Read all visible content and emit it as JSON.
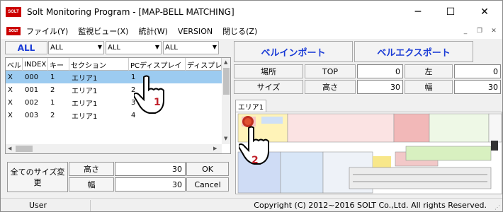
{
  "window": {
    "logo_text": "SOLT",
    "title": "Solt Monitoring Program - [MAP-BELL MATCHING]",
    "minimize": "─",
    "maximize": "☐",
    "close": "✕"
  },
  "menu": {
    "logo_text": "SOLT",
    "items": [
      "ファイル(Y)",
      "監視ビュー(X)",
      "統計(W)",
      "VERSION",
      "閉じる(Z)"
    ],
    "mdi_min": "_",
    "mdi_restore": "❐",
    "mdi_close": "✕"
  },
  "filters": {
    "all_button": "ALL",
    "dropdowns": [
      "ALL",
      "ALL",
      "ALL"
    ]
  },
  "table": {
    "columns": [
      "ベル",
      "INDEX",
      "キー",
      "セクション",
      "PCディスプレイ",
      "ディスプレ"
    ],
    "rows": [
      {
        "bell": "X",
        "index": "000",
        "key": "1",
        "section": "エリア1",
        "pc": "1"
      },
      {
        "bell": "X",
        "index": "001",
        "key": "2",
        "section": "エリア1",
        "pc": "2"
      },
      {
        "bell": "X",
        "index": "002",
        "key": "1",
        "section": "エリア1",
        "pc": "3"
      },
      {
        "bell": "X",
        "index": "003",
        "key": "2",
        "section": "エリア1",
        "pc": "4"
      }
    ],
    "selected_row": 0
  },
  "size_panel": {
    "label": "全てのサイズ変更",
    "height_label": "高さ",
    "width_label": "幅",
    "height_value": "30",
    "width_value": "30",
    "ok": "OK",
    "cancel": "Cancel"
  },
  "actions": {
    "import": "ベルインポート",
    "export": "ベルエクスポート"
  },
  "props": {
    "place_label": "場所",
    "top_label": "TOP",
    "top_value": "0",
    "left_label": "左",
    "left_value": "0",
    "size_label": "サイズ",
    "height_label": "高さ",
    "height_value": "30",
    "width_label": "幅",
    "width_value": "30"
  },
  "map": {
    "tab": "エリア1"
  },
  "annotations": {
    "step1": "1",
    "step2": "2",
    "badge_color": "#c0202a"
  },
  "status": {
    "user": "User",
    "copyright": "Copyright (C) 2012~2016 SOLT Co.,Ltd. All rights Reserved."
  }
}
